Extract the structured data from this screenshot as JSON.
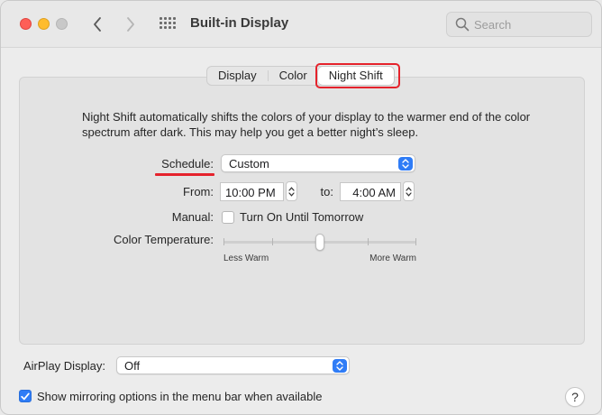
{
  "window": {
    "title": "Built-in Display"
  },
  "search": {
    "placeholder": "Search"
  },
  "tabs": [
    {
      "label": "Display",
      "active": false
    },
    {
      "label": "Color",
      "active": false
    },
    {
      "label": "Night Shift",
      "active": true
    }
  ],
  "night_shift": {
    "description": "Night Shift automatically shifts the colors of your display to the warmer end of the color spectrum after dark. This may help you get a better night’s sleep.",
    "schedule_label": "Schedule:",
    "schedule_value": "Custom",
    "from_label": "From:",
    "from_value": "10:00 PM",
    "to_label": "to:",
    "to_value": "4:00 AM",
    "manual_label": "Manual:",
    "manual_checkbox_label": "Turn On Until Tomorrow",
    "manual_checked": false,
    "color_temp_label": "Color Temperature:",
    "color_temp_level": 0.5,
    "less_warm_label": "Less Warm",
    "more_warm_label": "More Warm"
  },
  "airplay": {
    "label": "AirPlay Display:",
    "value": "Off"
  },
  "mirroring": {
    "label": "Show mirroring options in the menu bar when available",
    "checked": true
  },
  "help": {
    "label": "?"
  },
  "colors": {
    "accent": "#2f7cf6",
    "highlight": "#e5232c"
  }
}
